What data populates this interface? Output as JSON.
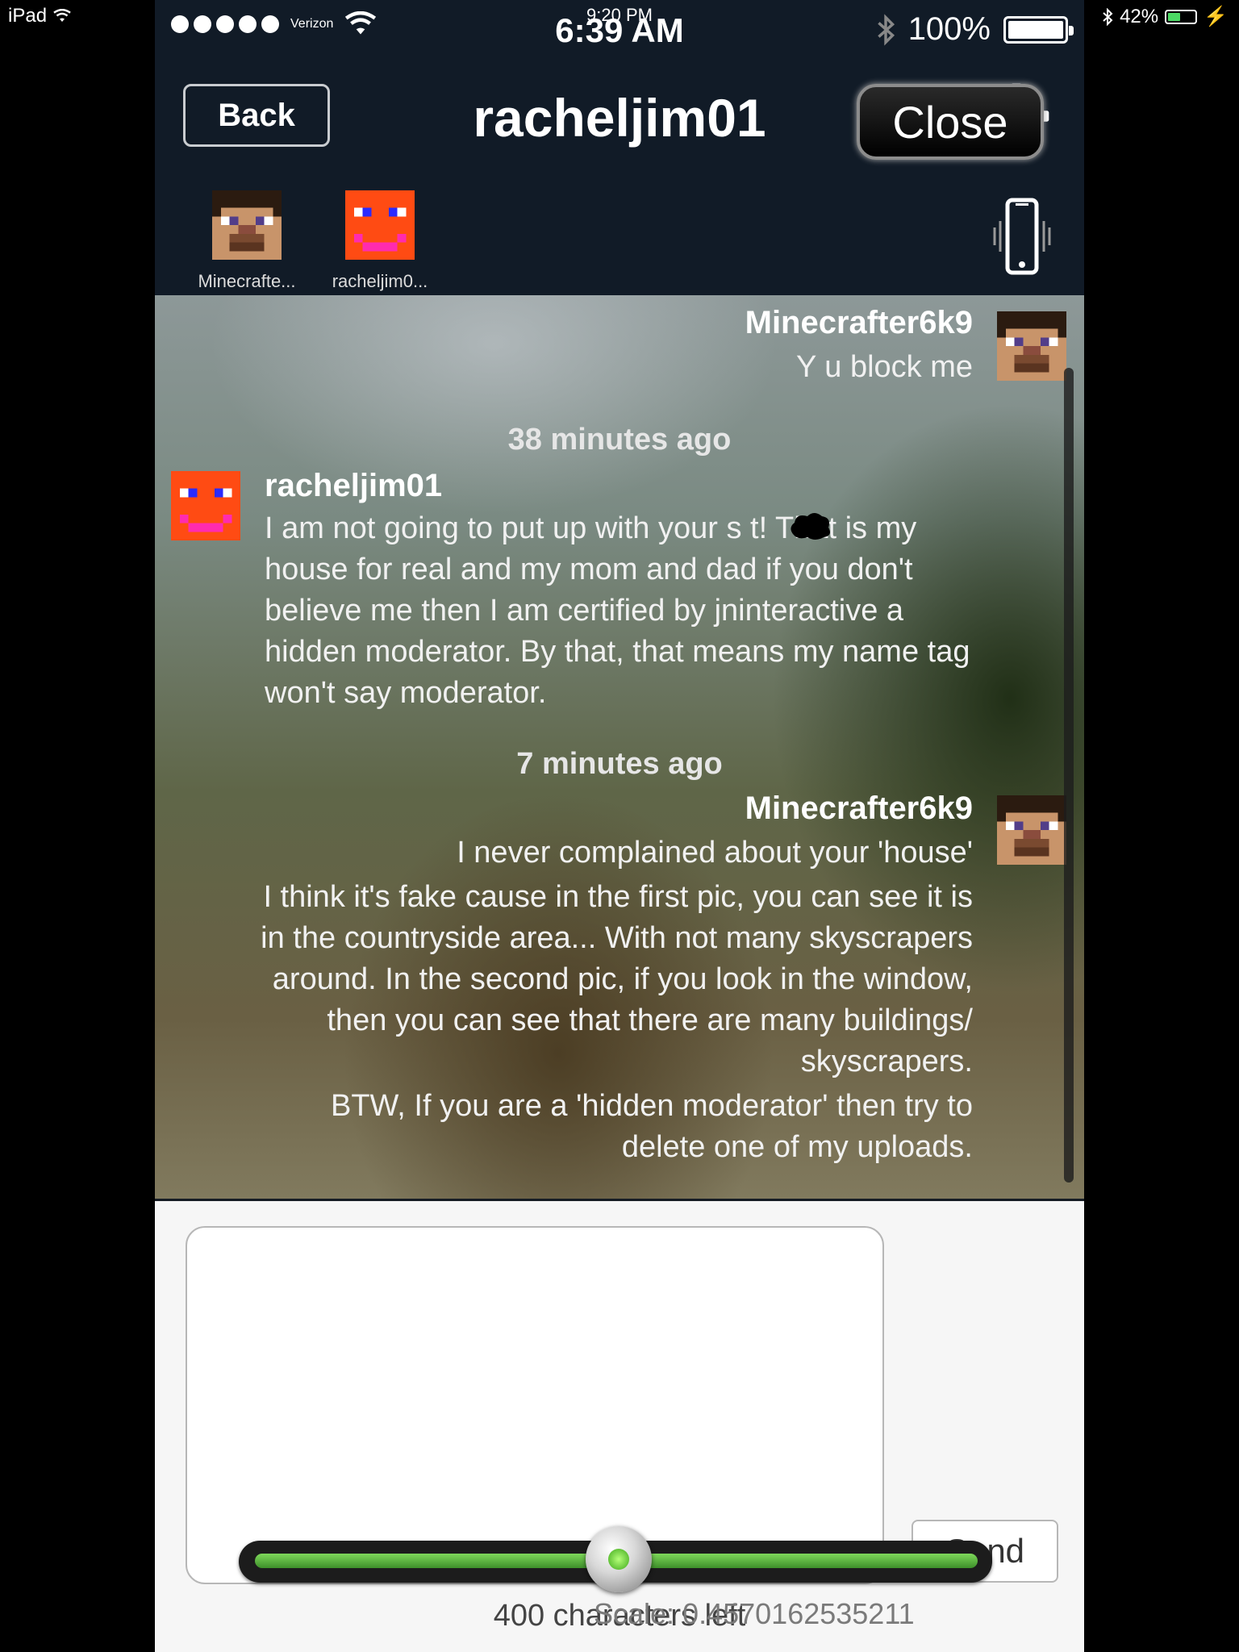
{
  "ipad_status": {
    "device": "iPad",
    "time": "9:20 PM",
    "battery": "42%"
  },
  "phone_status": {
    "carrier": "Verizon",
    "time": "6:39 AM",
    "battery": "100%"
  },
  "nav": {
    "back_label": "Back",
    "title": "racheljim01",
    "close_label": "Close"
  },
  "participants": [
    {
      "name": "Minecrafte...",
      "avatar": "steve-avatar"
    },
    {
      "name": "racheljim0...",
      "avatar": "orange-face-avatar"
    }
  ],
  "messages": [
    {
      "sender": "Minecrafter6k9",
      "lines": [
        "Y u block me"
      ]
    },
    {
      "time": "38 minutes ago"
    },
    {
      "sender": "racheljim01",
      "lines": [
        "I am not going to put up with your s  t! That is my",
        "house for real and my mom and dad if you don't",
        "believe me then I am certified by jninteractive a",
        "hidden moderator. By that, that means my name tag",
        "won't say moderator."
      ]
    },
    {
      "time": "7 minutes ago"
    },
    {
      "sender": "Minecrafter6k9",
      "lines": [
        "I never complained about your 'house'",
        "I think it's fake cause in the first pic, you can see it is",
        "in the countryside area... With not many skyscrapers",
        "around. In the second pic, if you look in the window,",
        "then you can see that there are many buildings/",
        "skyscrapers.",
        "BTW, If you are a 'hidden moderator' then try to",
        "delete one of my uploads."
      ]
    }
  ],
  "composer": {
    "send_label": "Send",
    "chars_left": "400 characters left",
    "scale_overlay": "Scale: 0.4570162535211"
  },
  "colors": {
    "header_bg": "#111b27",
    "slider_green": "#5cbf3a"
  }
}
